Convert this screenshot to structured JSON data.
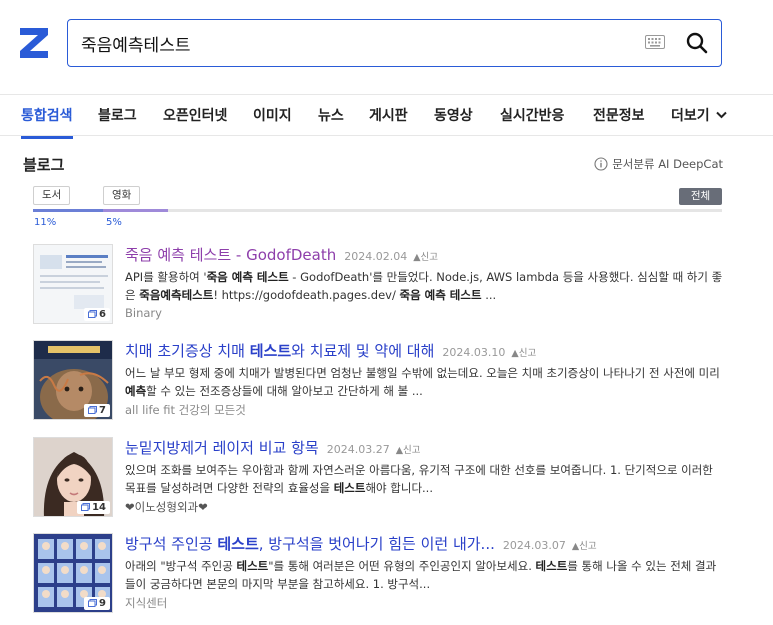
{
  "search": {
    "query": "죽음예측테스트"
  },
  "tabs": [
    {
      "label": "통합검색",
      "active": true
    },
    {
      "label": "블로그"
    },
    {
      "label": "오픈인터넷"
    },
    {
      "label": "이미지"
    },
    {
      "label": "뉴스"
    },
    {
      "label": "게시판"
    },
    {
      "label": "동영상"
    },
    {
      "label": "실시간반응"
    },
    {
      "label": "전문정보"
    },
    {
      "label": "더보기"
    }
  ],
  "section": {
    "title": "블로그",
    "classifier_label": "문서분류 AI DeepCat"
  },
  "filters": {
    "chips": [
      {
        "label": "도서",
        "percent": "11%",
        "share": 0.11
      },
      {
        "label": "영화",
        "percent": "5%",
        "share": 0.05
      }
    ],
    "all_label": "전체"
  },
  "results": [
    {
      "title_parts": [
        {
          "text": "죽음 예측 테스트",
          "bold": false
        },
        {
          "text": " - GodofDeath",
          "bold": false
        }
      ],
      "visited": true,
      "date": "2024.02.04",
      "report": "신고",
      "desc_parts": [
        {
          "text": "API를 활용하여 '",
          "bold": false
        },
        {
          "text": "죽음 예측 테스트",
          "bold": true
        },
        {
          "text": " - GodofDeath'를 만들었다. Node.js, AWS lambda 등을 사용했다. 심심할 때 하기 좋은 ",
          "bold": false
        },
        {
          "text": "죽음예측테스트",
          "bold": true
        },
        {
          "text": "! https://godofdeath.pages.dev/ ",
          "bold": false
        },
        {
          "text": "죽음 예측 테스트",
          "bold": true
        },
        {
          "text": " ...",
          "bold": false
        }
      ],
      "source": "Binary",
      "image_count": "6"
    },
    {
      "title_parts": [
        {
          "text": "치매 초기증상 치매 ",
          "bold": false
        },
        {
          "text": "테스트",
          "bold": true
        },
        {
          "text": "와 치료제 및 약에 대해",
          "bold": false
        }
      ],
      "visited": false,
      "date": "2024.03.10",
      "report": "신고",
      "desc_parts": [
        {
          "text": "어느 날 부모 형제 중에 치매가 발병된다면 엄청난 불행일 수밖에 없는데요. 오늘은 치매 초기증상이 나타나기 전 사전에 미리",
          "bold": false
        },
        {
          "text": "예측",
          "bold": true
        },
        {
          "text": "할 수 있는 전조증상들에 대해 알아보고 간단하게 해 볼 ...",
          "bold": false
        }
      ],
      "source": "all life fit 건강의 모든것",
      "image_count": "7"
    },
    {
      "title_parts": [
        {
          "text": "눈밑지방제거 레이저 비교 항목",
          "bold": false
        }
      ],
      "visited": false,
      "date": "2024.03.27",
      "report": "신고",
      "desc_parts": [
        {
          "text": "있으며 조화를 보여주는 우아함과 함께 자연스러운 아름다움, 유기적 구조에 대한 선호를 보여줍니다. 1. 단기적으로 이러한 목표를 달성하려면 다양한 전략의 효율성을 ",
          "bold": false
        },
        {
          "text": "테스트",
          "bold": true
        },
        {
          "text": "해야 합니다...",
          "bold": false
        }
      ],
      "source": "❤이노성형외과❤",
      "image_count": "14"
    },
    {
      "title_parts": [
        {
          "text": "방구석 주인공 ",
          "bold": false
        },
        {
          "text": "테스트",
          "bold": true
        },
        {
          "text": ", 방구석을 벗어나기 힘든 이런 내가...",
          "bold": false
        }
      ],
      "visited": false,
      "date": "2024.03.07",
      "report": "신고",
      "desc_parts": [
        {
          "text": "아래의 \"방구석 주인공 ",
          "bold": false
        },
        {
          "text": "테스트",
          "bold": true
        },
        {
          "text": "\"를 통해 여러분은 어떤 유형의 주인공인지 알아보세요. ",
          "bold": false
        },
        {
          "text": "테스트",
          "bold": true
        },
        {
          "text": "를 통해 나올 수 있는 전체 결과들이 궁금하다면 본문의 마지막 부분을 참고하세요. 1. 방구석...",
          "bold": false
        }
      ],
      "source": "지식센터",
      "image_count": "9"
    }
  ],
  "colors": {
    "accent": "#2a5bd7",
    "link": "#2a40c9",
    "visited": "#8e3fab"
  }
}
